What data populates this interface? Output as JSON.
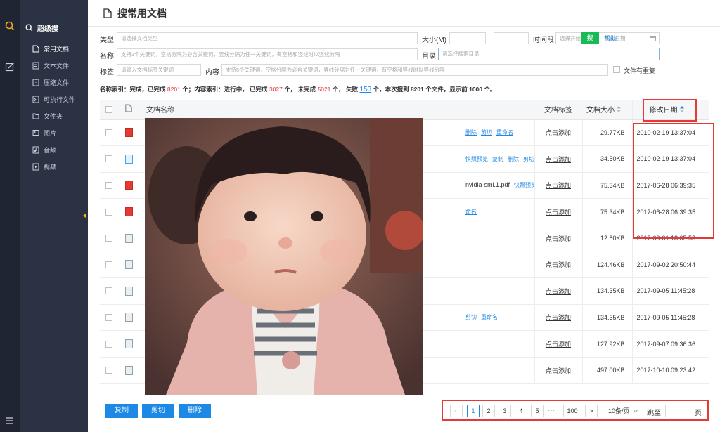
{
  "page_title": "搜常用文档",
  "sidebar": {
    "title": "超级搜",
    "items": [
      {
        "label": "常用文档",
        "icon": "document-icon"
      },
      {
        "label": "文本文件",
        "icon": "text-file-icon"
      },
      {
        "label": "压缩文件",
        "icon": "archive-icon"
      },
      {
        "label": "可执行文件",
        "icon": "executable-icon"
      },
      {
        "label": "文件夹",
        "icon": "folder-icon"
      },
      {
        "label": "图片",
        "icon": "image-icon"
      },
      {
        "label": "音频",
        "icon": "audio-icon"
      },
      {
        "label": "视频",
        "icon": "video-icon"
      }
    ]
  },
  "filters": {
    "type_label": "类型",
    "type_placeholder": "请选择文档类型",
    "size_label": "大小(M)",
    "size_sep": "-",
    "time_label": "时间段",
    "time_start": "选择开始日...",
    "time_arrow": "→",
    "time_end": "截止日期",
    "search_button": "搜",
    "help_link": "帮助",
    "name_label": "名称",
    "name_placeholder": "支持3个关键词，空格分隔为必含关键词，竖线分隔为任一关键词，有空格和竖线时以竖线分隔",
    "dir_label": "目录",
    "dir_placeholder": "请选择搜索目录",
    "tag_label": "标签",
    "tag_placeholder": "请输入文档标签关键词",
    "content_label": "内容",
    "content_placeholder": "支持5个关键词，空格分隔为必含关键词，竖线分隔为任一关键词，有空格和竖线时以竖线分隔",
    "dup_label": "文件有重复"
  },
  "stats": {
    "p1": "名称索引：完成，已完成",
    "name_done": "8201",
    "p2": "个；内容索引：进行中， 已完成",
    "content_done": "3027",
    "p3": "个， 未完成",
    "content_todo": "5021",
    "p4": "个， 失败",
    "failed": "153",
    "p5": "个，本次搜到 8201 个文件，显示前 1000 个。"
  },
  "table": {
    "headers": {
      "name": "文档名称",
      "tag": "文档标签",
      "size": "文档大小",
      "date": "修改日期"
    },
    "rows": [
      {
        "type": "pdf",
        "name": "",
        "actions": [
          "删除",
          "剪切",
          "重命名"
        ],
        "tag": "点击添加",
        "size": "29.77KB",
        "date": "2010-02-19 13:37:04"
      },
      {
        "type": "doc",
        "name": "",
        "actions": [
          "快照预览",
          "复制",
          "删除",
          "剪切"
        ],
        "tag": "点击添加",
        "size": "34.50KB",
        "date": "2010-02-19 13:37:04"
      },
      {
        "type": "pdf",
        "name": "nvidia-smi.1.pdf",
        "actions": [
          "快照预览"
        ],
        "tag": "点击添加",
        "size": "75.34KB",
        "date": "2017-06-28 06:39:35"
      },
      {
        "type": "pdf",
        "name": "",
        "actions": [
          "命名"
        ],
        "tag": "点击添加",
        "size": "75.34KB",
        "date": "2017-06-28 06:39:35"
      },
      {
        "type": "gen",
        "name": "",
        "actions": [],
        "tag": "点击添加",
        "size": "12.80KB",
        "date": "2017-09-01 18:05:58"
      },
      {
        "type": "gen",
        "name": "",
        "actions": [],
        "tag": "点击添加",
        "size": "124.46KB",
        "date": "2017-09-02 20:50:44"
      },
      {
        "type": "gen",
        "name": "",
        "actions": [],
        "tag": "点击添加",
        "size": "134.35KB",
        "date": "2017-09-05 11:45:28"
      },
      {
        "type": "gen",
        "name": "",
        "actions": [
          "剪切",
          "重命名"
        ],
        "tag": "点击添加",
        "size": "134.35KB",
        "date": "2017-09-05 11:45:28"
      },
      {
        "type": "gen",
        "name": "",
        "actions": [],
        "tag": "点击添加",
        "size": "127.92KB",
        "date": "2017-09-07 09:36:36"
      },
      {
        "type": "gen",
        "name": "",
        "actions": [],
        "tag": "点击添加",
        "size": "497.00KB",
        "date": "2017-10-10 09:23:42"
      }
    ]
  },
  "footer": {
    "copy": "复制",
    "cut": "剪切",
    "delete": "删除"
  },
  "pagination": {
    "prev": "<",
    "pages": [
      "1",
      "2",
      "3",
      "4",
      "5"
    ],
    "ellipsis": "···",
    "last": "100",
    "next": ">",
    "per_page": "10条/页",
    "goto_label": "跳至",
    "page_unit": "页"
  },
  "colors": {
    "accent": "#1e88e5",
    "highlight": "#e53935",
    "green": "#19b955",
    "sidebar": "#2b3243"
  }
}
